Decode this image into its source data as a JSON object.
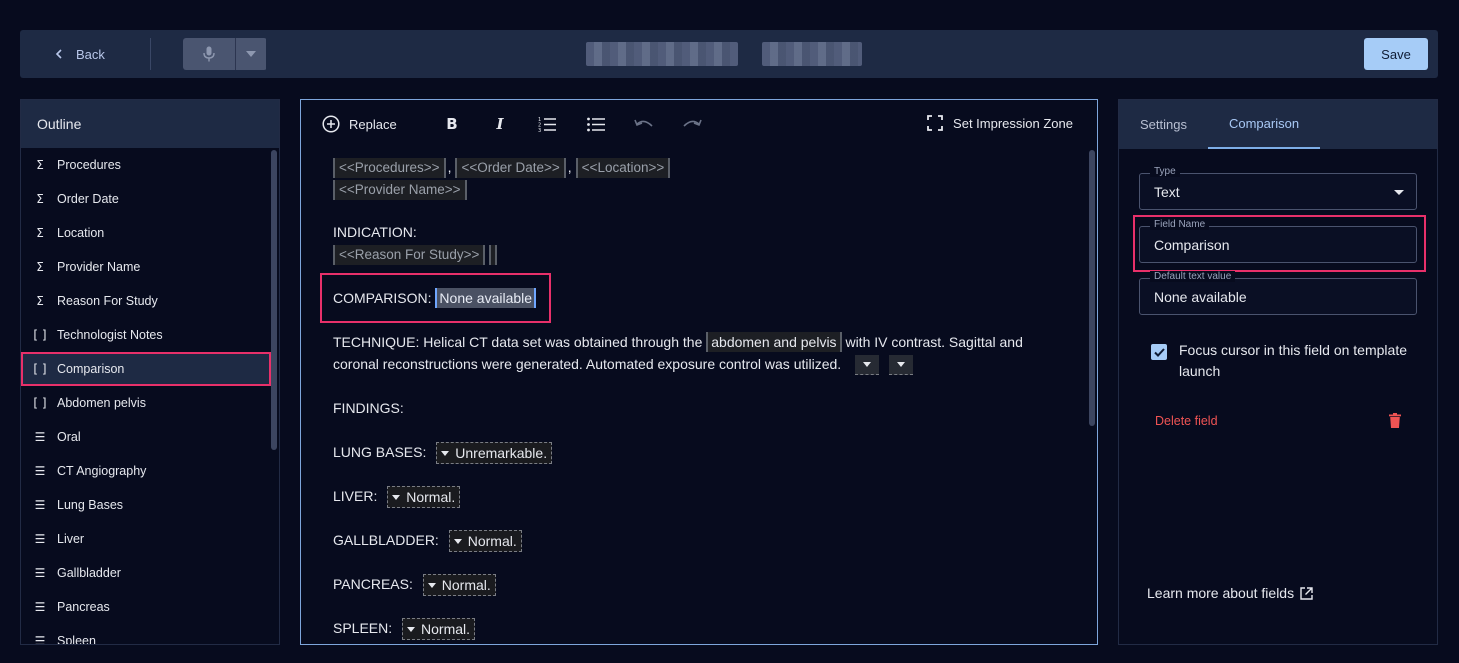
{
  "topbar": {
    "back_label": "Back",
    "save_label": "Save"
  },
  "outline": {
    "title": "Outline",
    "items": [
      {
        "icon": "sigma-icon",
        "glyph": "Σ",
        "label": "Procedures"
      },
      {
        "icon": "sigma-icon",
        "glyph": "Σ",
        "label": "Order Date"
      },
      {
        "icon": "sigma-icon",
        "glyph": "Σ",
        "label": "Location"
      },
      {
        "icon": "sigma-icon",
        "glyph": "Σ",
        "label": "Provider Name"
      },
      {
        "icon": "sigma-icon",
        "glyph": "Σ",
        "label": "Reason For Study"
      },
      {
        "icon": "brackets-icon",
        "glyph": "[ ]",
        "label": "Technologist Notes"
      },
      {
        "icon": "brackets-icon",
        "glyph": "[ ]",
        "label": "Comparison"
      },
      {
        "icon": "brackets-icon",
        "glyph": "[ ]",
        "label": "Abdomen pelvis"
      },
      {
        "icon": "list-icon",
        "glyph": "☰",
        "label": "Oral"
      },
      {
        "icon": "list-icon",
        "glyph": "☰",
        "label": "CT Angiography"
      },
      {
        "icon": "list-icon",
        "glyph": "☰",
        "label": "Lung Bases"
      },
      {
        "icon": "list-icon",
        "glyph": "☰",
        "label": "Liver"
      },
      {
        "icon": "list-icon",
        "glyph": "☰",
        "label": "Gallbladder"
      },
      {
        "icon": "list-icon",
        "glyph": "☰",
        "label": "Pancreas"
      },
      {
        "icon": "list-icon",
        "glyph": "☰",
        "label": "Spleen"
      }
    ],
    "selected_index": 6
  },
  "toolbar": {
    "replace_label": "Replace",
    "impression_label": "Set Impression Zone"
  },
  "doc": {
    "tag_procedures": "<<Procedures>>",
    "tag_order_date": "<<Order Date>>",
    "tag_location": "<<Location>>",
    "tag_provider": "<<Provider Name>>",
    "sep": ",",
    "indication_label": "INDICATION:",
    "tag_reason": "<<Reason For Study>>",
    "comparison_label": "COMPARISON:",
    "comparison_value": "None available",
    "technique_pre": "TECHNIQUE: Helical CT data set was obtained through the",
    "technique_field": "abdomen and pelvis",
    "technique_post": "with IV contrast. Sagittal and",
    "technique_line2": "coronal reconstructions were generated. Automated exposure control was utilized.",
    "findings_label": "FINDINGS:",
    "lung_label": "LUNG BASES:",
    "lung_value": "Unremarkable.",
    "liver_label": "LIVER:",
    "liver_value": "Normal.",
    "gallbladder_label": "GALLBLADDER:",
    "gallbladder_value": "Normal.",
    "pancreas_label": "PANCREAS:",
    "pancreas_value": "Normal.",
    "spleen_label": "SPLEEN:",
    "spleen_value": "Normal."
  },
  "rpanel": {
    "tabs": [
      "Settings",
      "Comparison"
    ],
    "active_tab": 1,
    "type_label": "Type",
    "type_value": "Text",
    "field_name_label": "Field Name",
    "field_name_value": "Comparison",
    "default_label": "Default text value",
    "default_value": "None available",
    "focus_checkbox_label": "Focus cursor in this field on template launch",
    "focus_checked": true,
    "delete_label": "Delete field",
    "learn_more_label": "Learn more about fields"
  },
  "colors": {
    "accent": "#a6ccf7",
    "highlight": "#e8306a",
    "danger": "#f05454",
    "panel": "#1e2a44"
  }
}
